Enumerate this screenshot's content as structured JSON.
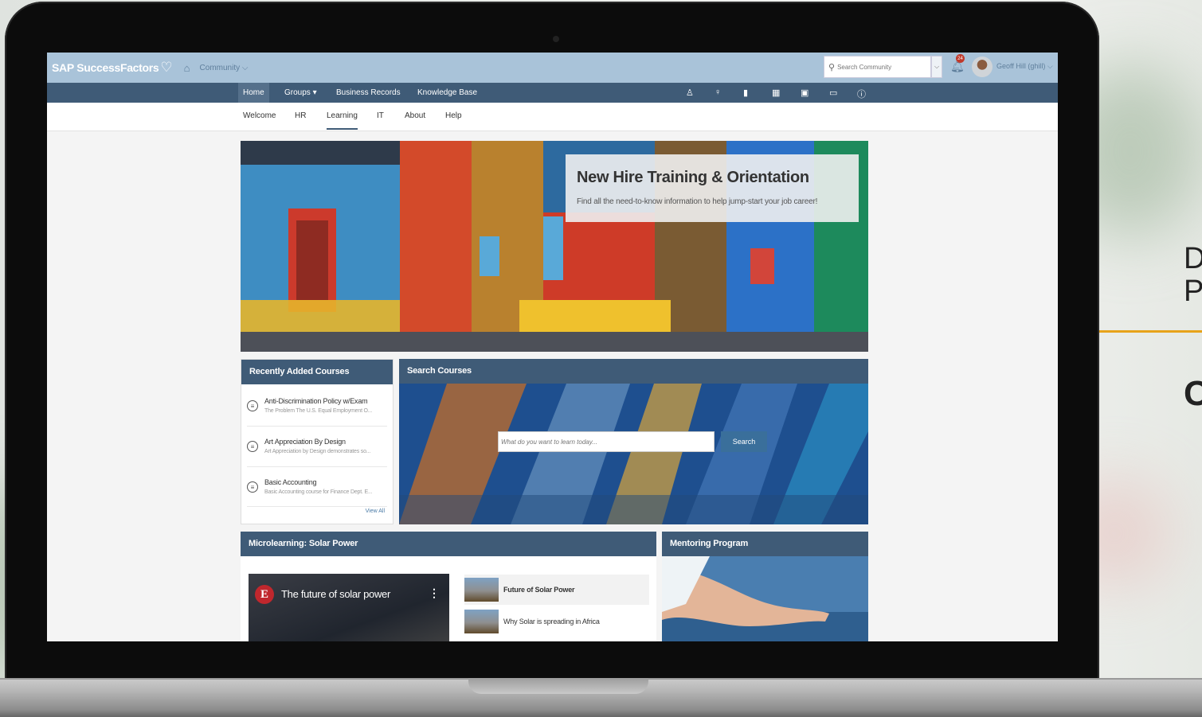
{
  "side": {
    "line1": "D",
    "line2": "P",
    "line3": "C"
  },
  "topbar": {
    "brand": "SAP SuccessFactors",
    "community": "Community ⌵",
    "search_placeholder": "Search Community",
    "notification_count": "24",
    "user_name": "Geoff Hill (ghill) ⌵"
  },
  "nav": {
    "items": [
      "Home",
      "Groups ▾",
      "Business Records",
      "Knowledge Base"
    ],
    "icons": [
      "person-icon",
      "lightbulb-icon",
      "bookmark-icon",
      "calendar-icon",
      "clipboard-icon",
      "chat-icon",
      "help-icon"
    ]
  },
  "subnav": {
    "items": [
      "Welcome",
      "HR",
      "Learning",
      "IT",
      "About",
      "Help"
    ],
    "active": "Learning"
  },
  "hero": {
    "title": "New Hire Training & Orientation",
    "subtitle": "Find all the need-to-know information to help jump-start your job career!"
  },
  "recent": {
    "title": "Recently Added Courses",
    "courses": [
      {
        "title": "Anti-Discrimination Policy w/Exam",
        "desc": "The Problem The U.S. Equal Employment O..."
      },
      {
        "title": "Art Appreciation By Design",
        "desc": "Art Appreciation by Design demonstrates so..."
      },
      {
        "title": "Basic Accounting",
        "desc": "Basic Accounting course for Finance Dept. E..."
      }
    ],
    "view_all": "View All"
  },
  "search_courses": {
    "title": "Search Courses",
    "placeholder": "What do you want to learn today...",
    "button": "Search"
  },
  "micro": {
    "title": "Microlearning: Solar Power",
    "video_title": "The future of solar power",
    "video_logo": "E",
    "items": [
      "Future of Solar Power",
      "Why Solar is spreading in Africa"
    ]
  },
  "mentoring": {
    "title": "Mentoring Program"
  }
}
